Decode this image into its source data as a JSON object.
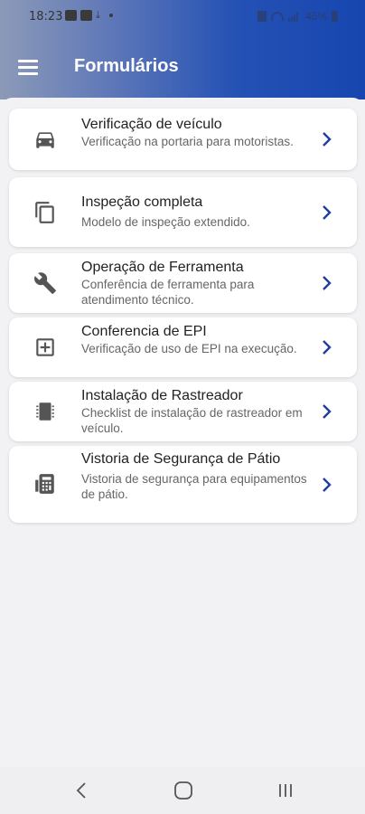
{
  "status_bar": {
    "time": "18:23",
    "battery": "45%"
  },
  "app_bar": {
    "title": "Formulários",
    "menu_icon": "menu-icon"
  },
  "forms": [
    {
      "title": "Verificação de veículo",
      "subtitle": "Verificação na portaria para motoristas.",
      "icon": "car-icon"
    },
    {
      "title": "Inspeção completa",
      "subtitle": "Modelo de inspeção extendido.",
      "icon": "copy-icon"
    },
    {
      "title": "Operação de Ferramenta",
      "subtitle": "Conferência de ferramenta para atendimento técnico.",
      "icon": "wrench-icon"
    },
    {
      "title": "Conferencia de EPI",
      "subtitle": "Verificação de uso de EPI na execução.",
      "icon": "plus-box-icon"
    },
    {
      "title": "Instalação de Rastreador",
      "subtitle": "Checklist de instalação de rastreador em veículo.",
      "icon": "chip-icon"
    },
    {
      "title": "Vistoria de Segurança de Pátio",
      "subtitle": "Vistoria de segurança para equipamentos de pátio.",
      "icon": "calculator-icon"
    }
  ],
  "colors": {
    "accent": "#1746b0",
    "chevron": "#1f3f9a",
    "background": "#f2f2f4"
  },
  "nav": {
    "back": "back-icon",
    "home": "home-icon",
    "recents": "recents-icon"
  }
}
